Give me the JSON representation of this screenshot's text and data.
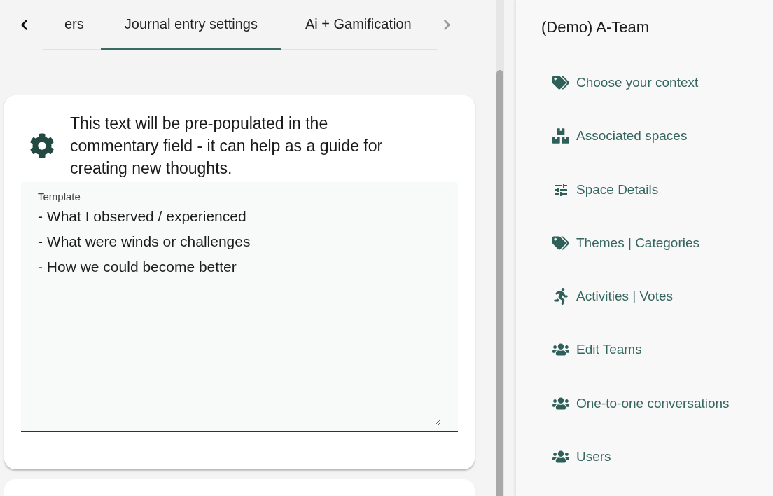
{
  "tabs": [
    {
      "label": "ers",
      "selected": false
    },
    {
      "label": "Journal entry settings",
      "selected": true
    },
    {
      "label": "Ai + Gamification",
      "selected": false
    }
  ],
  "card": {
    "description": "This text will be pre-populated in the commentary field - it can help as a guide for creating new thoughts.",
    "field": {
      "label": "Template",
      "value": "- What I observed / experienced\n- What were winds or challenges\n- How we could become better"
    }
  },
  "sidebar": {
    "title": "(Demo) A-Team",
    "items": [
      {
        "label": "Choose your context"
      },
      {
        "label": "Associated spaces"
      },
      {
        "label": "Space Details"
      },
      {
        "label": "Themes | Categories"
      },
      {
        "label": "Activities | Votes"
      },
      {
        "label": "Edit Teams"
      },
      {
        "label": "One-to-one conversations"
      },
      {
        "label": "Users"
      }
    ]
  }
}
